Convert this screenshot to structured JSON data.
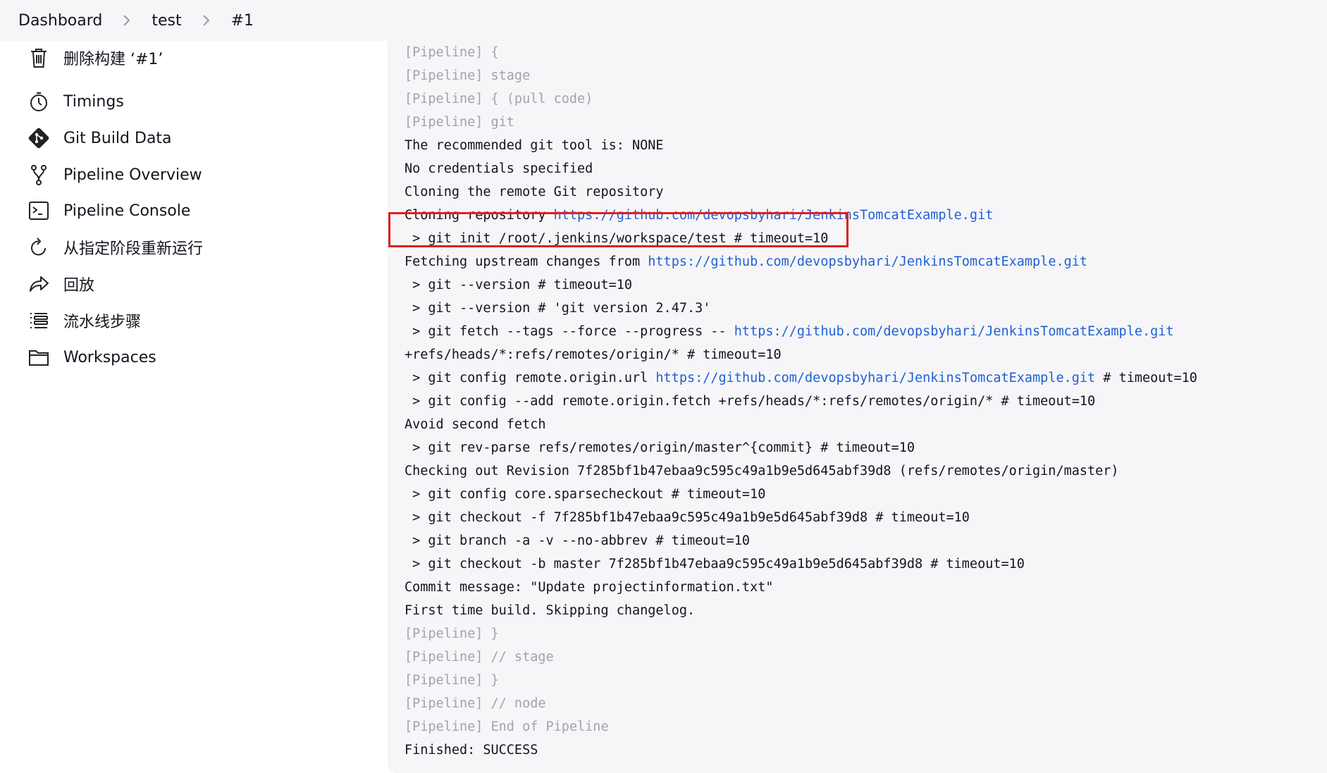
{
  "breadcrumb": {
    "items": [
      "Dashboard",
      "test",
      "#1"
    ]
  },
  "sidebar": {
    "items": [
      {
        "label": "删除构建 ‘#1’",
        "icon": "trash-icon"
      },
      {
        "label": "Timings",
        "icon": "stopwatch-icon"
      },
      {
        "label": "Git Build Data",
        "icon": "git-icon"
      },
      {
        "label": "Pipeline Overview",
        "icon": "branch-icon"
      },
      {
        "label": "Pipeline Console",
        "icon": "terminal-icon"
      },
      {
        "label": "从指定阶段重新运行",
        "icon": "restart-icon"
      },
      {
        "label": "回放",
        "icon": "replay-arrow-icon"
      },
      {
        "label": "流水线步骤",
        "icon": "list-steps-icon"
      },
      {
        "label": "Workspaces",
        "icon": "folder-icon"
      }
    ]
  },
  "console": {
    "highlight_color": "#e02020",
    "link_color": "#1f60d6",
    "lines": [
      {
        "dim": true,
        "parts": [
          {
            "text": "[Pipeline] {"
          }
        ]
      },
      {
        "dim": true,
        "parts": [
          {
            "text": "[Pipeline] stage"
          }
        ]
      },
      {
        "dim": true,
        "parts": [
          {
            "text": "[Pipeline] { (pull code)"
          }
        ]
      },
      {
        "dim": true,
        "parts": [
          {
            "text": "[Pipeline] git"
          }
        ]
      },
      {
        "parts": [
          {
            "text": "The recommended git tool is: NONE"
          }
        ]
      },
      {
        "parts": [
          {
            "text": "No credentials specified"
          }
        ]
      },
      {
        "parts": [
          {
            "text": "Cloning the remote Git repository"
          }
        ]
      },
      {
        "parts": [
          {
            "text": "Cloning repository "
          },
          {
            "text": "https://github.com/devopsbyhari/JenkinsTomcatExample.git",
            "link": true
          }
        ]
      },
      {
        "parts": [
          {
            "text": " > git init /root/.jenkins/workspace/test # timeout=10"
          }
        ]
      },
      {
        "parts": [
          {
            "text": "Fetching upstream changes from "
          },
          {
            "text": "https://github.com/devopsbyhari/JenkinsTomcatExample.git",
            "link": true
          }
        ]
      },
      {
        "parts": [
          {
            "text": " > git --version # timeout=10"
          }
        ]
      },
      {
        "parts": [
          {
            "text": " > git --version # 'git version 2.47.3'"
          }
        ]
      },
      {
        "parts": [
          {
            "text": " > git fetch --tags --force --progress -- "
          },
          {
            "text": "https://github.com/devopsbyhari/JenkinsTomcatExample.git",
            "link": true
          }
        ]
      },
      {
        "parts": [
          {
            "text": "+refs/heads/*:refs/remotes/origin/* # timeout=10"
          }
        ]
      },
      {
        "parts": [
          {
            "text": " > git config remote.origin.url "
          },
          {
            "text": "https://github.com/devopsbyhari/JenkinsTomcatExample.git",
            "link": true
          },
          {
            "text": " # timeout=10"
          }
        ]
      },
      {
        "parts": [
          {
            "text": " > git config --add remote.origin.fetch +refs/heads/*:refs/remotes/origin/* # timeout=10"
          }
        ]
      },
      {
        "parts": [
          {
            "text": "Avoid second fetch"
          }
        ]
      },
      {
        "parts": [
          {
            "text": " > git rev-parse refs/remotes/origin/master^{commit} # timeout=10"
          }
        ]
      },
      {
        "parts": [
          {
            "text": "Checking out Revision 7f285bf1b47ebaa9c595c49a1b9e5d645abf39d8 (refs/remotes/origin/master)"
          }
        ]
      },
      {
        "parts": [
          {
            "text": " > git config core.sparsecheckout # timeout=10"
          }
        ]
      },
      {
        "parts": [
          {
            "text": " > git checkout -f 7f285bf1b47ebaa9c595c49a1b9e5d645abf39d8 # timeout=10"
          }
        ]
      },
      {
        "parts": [
          {
            "text": " > git branch -a -v --no-abbrev # timeout=10"
          }
        ]
      },
      {
        "parts": [
          {
            "text": " > git checkout -b master 7f285bf1b47ebaa9c595c49a1b9e5d645abf39d8 # timeout=10"
          }
        ]
      },
      {
        "parts": [
          {
            "text": "Commit message: \"Update projectinformation.txt\""
          }
        ]
      },
      {
        "parts": [
          {
            "text": "First time build. Skipping changelog."
          }
        ]
      },
      {
        "dim": true,
        "parts": [
          {
            "text": "[Pipeline] }"
          }
        ]
      },
      {
        "dim": true,
        "parts": [
          {
            "text": "[Pipeline] // stage"
          }
        ]
      },
      {
        "dim": true,
        "parts": [
          {
            "text": "[Pipeline] }"
          }
        ]
      },
      {
        "dim": true,
        "parts": [
          {
            "text": "[Pipeline] // node"
          }
        ]
      },
      {
        "dim": true,
        "parts": [
          {
            "text": "[Pipeline] End of Pipeline"
          }
        ]
      },
      {
        "parts": [
          {
            "text": "Finished: SUCCESS"
          }
        ]
      }
    ]
  }
}
